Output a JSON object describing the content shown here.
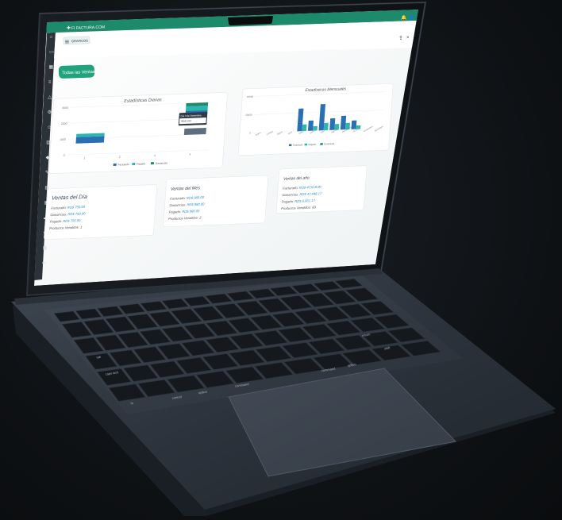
{
  "app": {
    "brand": "FI FACTURA.COM",
    "tab_label": "GRAFICOS",
    "sales_button": "Todas las Ventas",
    "accent": "#1e8a6c",
    "primary_blue": "#2a6fb3",
    "teal": "#2fb5b0",
    "title_icons": [
      "bell-icon",
      "user-icon"
    ],
    "toolbar_icons": [
      "share-icon",
      "close-icon"
    ],
    "sidebar_icons": [
      "home-icon",
      "folder-icon",
      "chart-icon",
      "list-icon",
      "warning-icon",
      "gear-icon",
      "user-icon",
      "inventory-icon",
      "tag-icon",
      "tool-icon",
      "receipt-icon",
      "report-icon",
      "truck-icon",
      "settings-icon",
      "grid-icon",
      "logout-icon"
    ]
  },
  "daily_chart": {
    "title": "Estadísticas Diarias",
    "legend": [
      "Facturado",
      "Pagado",
      "Ganancias"
    ],
    "y_ticks": [
      "3000",
      "2000",
      "1000",
      "0"
    ],
    "x_ticks": [
      "1",
      "2",
      "3",
      "4"
    ],
    "tooltip_title": "Día 3 de Noviembre",
    "tooltip_value": "RD$ 0.00"
  },
  "annual_chart": {
    "title": "Estadísticas Mensuales",
    "legend": [
      "Facturado",
      "Pagado",
      "Ganancias"
    ],
    "y_ticks": [
      "40000",
      "20000",
      "0"
    ],
    "x_ticks": [
      "Enero",
      "Febrero",
      "Marzo",
      "Abril",
      "Mayo",
      "Junio",
      "Julio",
      "Agosto",
      "Septiembre",
      "Octubre",
      "Noviembre",
      "Diciembre"
    ]
  },
  "cards": {
    "day": {
      "title": "Ventas del Día",
      "rows": [
        {
          "label": "Facturado:",
          "value": "RD$ 750.00"
        },
        {
          "label": "Ganancias:",
          "value": "RD$ 750.00"
        },
        {
          "label": "Pagado:",
          "value": "RD$ 750.00"
        },
        {
          "label": "Productos Vendidos:",
          "value": "1"
        }
      ]
    },
    "month": {
      "title": "Ventas del Mes",
      "rows": [
        {
          "label": "Facturado:",
          "value": "RD$ 980.00"
        },
        {
          "label": "Ganancias:",
          "value": "RD$ 980.00"
        },
        {
          "label": "Pagado:",
          "value": "RD$ 980.00"
        },
        {
          "label": "Productos Vendidos:",
          "value": "2"
        }
      ]
    },
    "year": {
      "title": "Ventas del año",
      "rows": [
        {
          "label": "Facturado:",
          "value": "RD$ 47,618.00"
        },
        {
          "label": "Ganancias:",
          "value": "RD$ 47,448.17"
        },
        {
          "label": "Pagado:",
          "value": "RD$ 6,661.17"
        },
        {
          "label": "Productos Vendidos:",
          "value": "60"
        }
      ]
    }
  },
  "keyboard": {
    "keys": [
      "command",
      "option",
      "control",
      "return",
      "shift",
      "caps lock",
      "tab",
      "command",
      "option",
      "fn"
    ]
  }
}
